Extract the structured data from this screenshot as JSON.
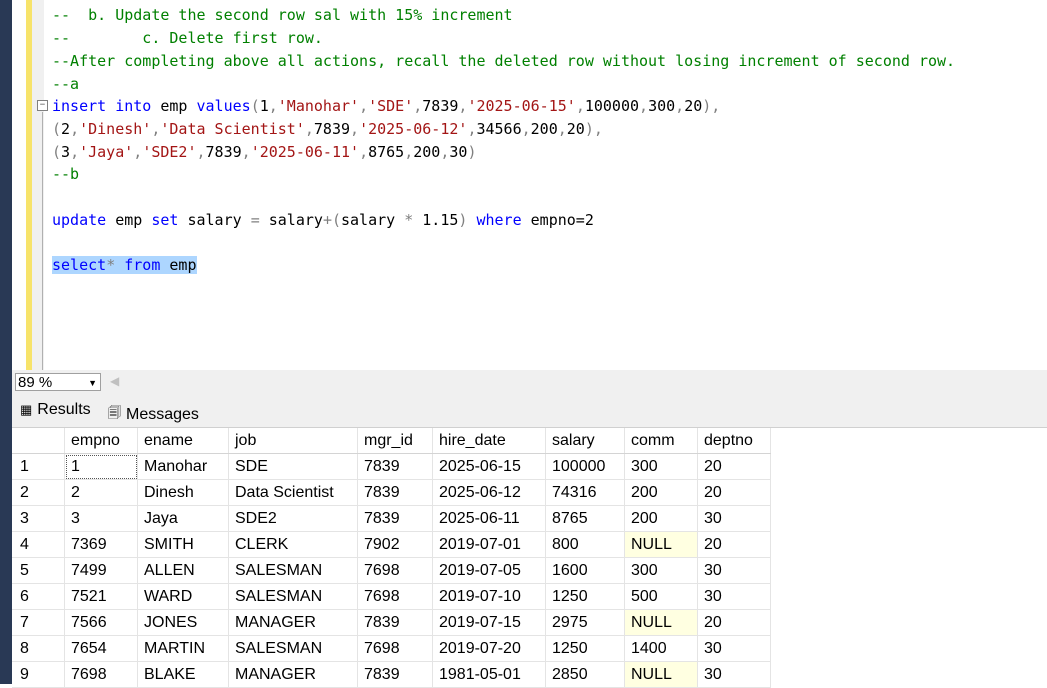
{
  "editor": {
    "lines": [
      {
        "type": "comment",
        "text": "--  b. Update the second row sal with 15% increment"
      },
      {
        "type": "comment",
        "text": "--        c. Delete first row."
      },
      {
        "type": "comment",
        "text": "--After completing above all actions, recall the deleted row without losing increment of second row."
      },
      {
        "type": "comment",
        "text": "--a"
      },
      {
        "type": "sql1"
      },
      {
        "type": "sql2"
      },
      {
        "type": "sql3"
      },
      {
        "type": "comment",
        "text": "--b"
      }
    ],
    "insert": {
      "kw_insert": "insert",
      "kw_into": "into",
      "table": "emp",
      "kw_values": "values",
      "row1": [
        "1",
        "'Manohar'",
        "'SDE'",
        "7839",
        "'2025-06-15'",
        "100000",
        "300",
        "20"
      ],
      "row2": [
        "2",
        "'Dinesh'",
        "'Data Scientist'",
        "7839",
        "'2025-06-12'",
        "34566",
        "200",
        "20"
      ],
      "row3": [
        "3",
        "'Jaya'",
        "'SDE2'",
        "7839",
        "'2025-06-11'",
        "8765",
        "200",
        "30"
      ]
    },
    "update": {
      "kw_update": "update",
      "table": "emp",
      "kw_set": "set",
      "col": "salary",
      "expr_col": "salary",
      "factor": "1.15",
      "kw_where": "where",
      "cond": "empno=2"
    },
    "select": {
      "kw_select": "select",
      "star": "*",
      "kw_from": "from",
      "table": "emp"
    }
  },
  "zoom": {
    "value": "89 %"
  },
  "tabs": {
    "results": "Results",
    "messages": "Messages"
  },
  "grid": {
    "columns": [
      "empno",
      "ename",
      "job",
      "mgr_id",
      "hire_date",
      "salary",
      "comm",
      "deptno"
    ],
    "rows": [
      [
        "1",
        "1",
        "Manohar",
        "SDE",
        "7839",
        "2025-06-15",
        "100000",
        "300",
        "20"
      ],
      [
        "2",
        "2",
        "Dinesh",
        "Data Scientist",
        "7839",
        "2025-06-12",
        "74316",
        "200",
        "20"
      ],
      [
        "3",
        "3",
        "Jaya",
        "SDE2",
        "7839",
        "2025-06-11",
        "8765",
        "200",
        "30"
      ],
      [
        "4",
        "7369",
        "SMITH",
        "CLERK",
        "7902",
        "2019-07-01",
        "800",
        "NULL",
        "20"
      ],
      [
        "5",
        "7499",
        "ALLEN",
        "SALESMAN",
        "7698",
        "2019-07-05",
        "1600",
        "300",
        "30"
      ],
      [
        "6",
        "7521",
        "WARD",
        "SALESMAN",
        "7698",
        "2019-07-10",
        "1250",
        "500",
        "30"
      ],
      [
        "7",
        "7566",
        "JONES",
        "MANAGER",
        "7839",
        "2019-07-15",
        "2975",
        "NULL",
        "20"
      ],
      [
        "8",
        "7654",
        "MARTIN",
        "SALESMAN",
        "7698",
        "2019-07-20",
        "1250",
        "1400",
        "30"
      ],
      [
        "9",
        "7698",
        "BLAKE",
        "MANAGER",
        "7839",
        "1981-05-01",
        "2850",
        "NULL",
        "30"
      ]
    ]
  }
}
